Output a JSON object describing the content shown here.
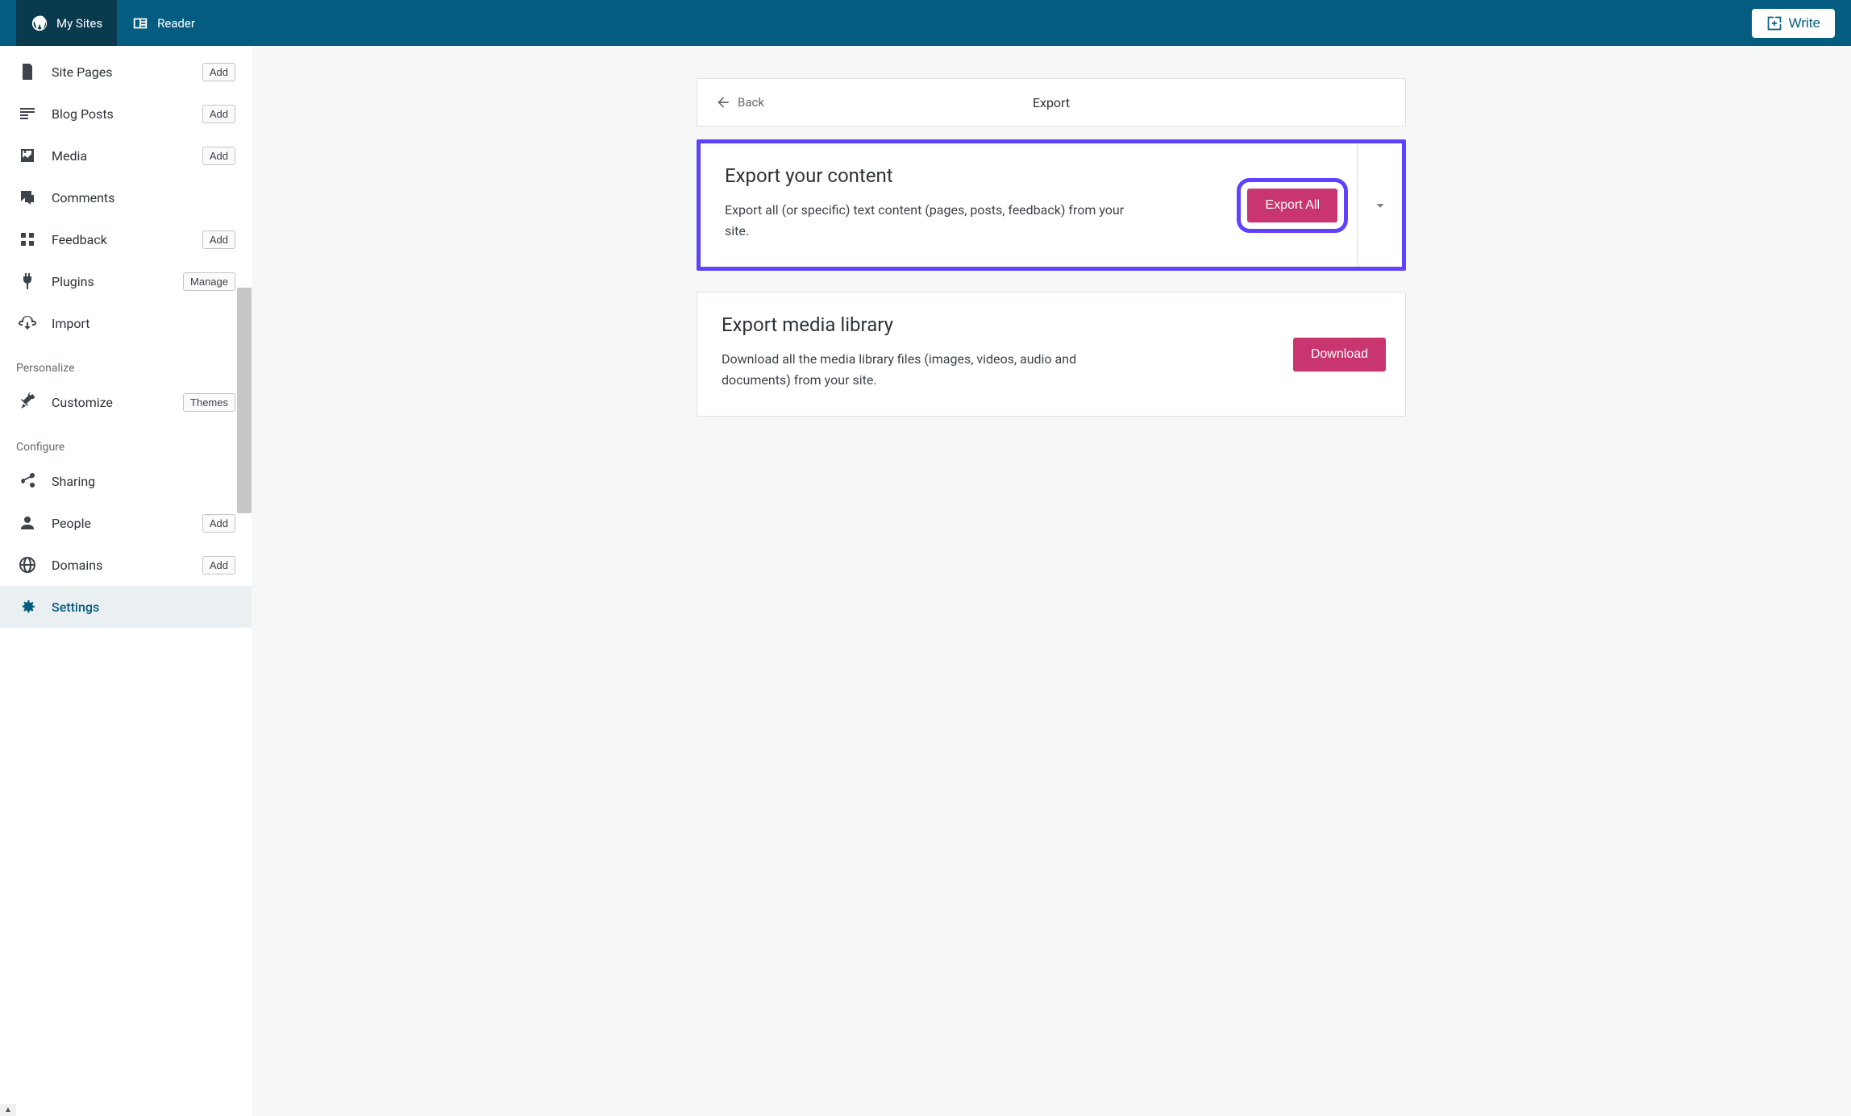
{
  "masterbar": {
    "my_sites": "My Sites",
    "reader": "Reader",
    "write": "Write"
  },
  "sidebar": {
    "items": [
      {
        "label": "Site Pages",
        "pill": "Add"
      },
      {
        "label": "Blog Posts",
        "pill": "Add"
      },
      {
        "label": "Media",
        "pill": "Add"
      },
      {
        "label": "Comments",
        "pill": ""
      },
      {
        "label": "Feedback",
        "pill": "Add"
      },
      {
        "label": "Plugins",
        "pill": "Manage"
      },
      {
        "label": "Import",
        "pill": ""
      }
    ],
    "personalize_heading": "Personalize",
    "customize": {
      "label": "Customize",
      "pill": "Themes"
    },
    "configure_heading": "Configure",
    "configure_items": [
      {
        "label": "Sharing",
        "pill": ""
      },
      {
        "label": "People",
        "pill": "Add"
      },
      {
        "label": "Domains",
        "pill": "Add"
      },
      {
        "label": "Settings",
        "pill": ""
      }
    ]
  },
  "header": {
    "back": "Back",
    "title": "Export"
  },
  "panels": {
    "content": {
      "title": "Export your content",
      "desc": "Export all (or specific) text content (pages, posts, feedback) from your site.",
      "button": "Export All"
    },
    "media": {
      "title": "Export media library",
      "desc": "Download all the media library files (images, videos, audio and documents) from your site.",
      "button": "Download"
    }
  }
}
